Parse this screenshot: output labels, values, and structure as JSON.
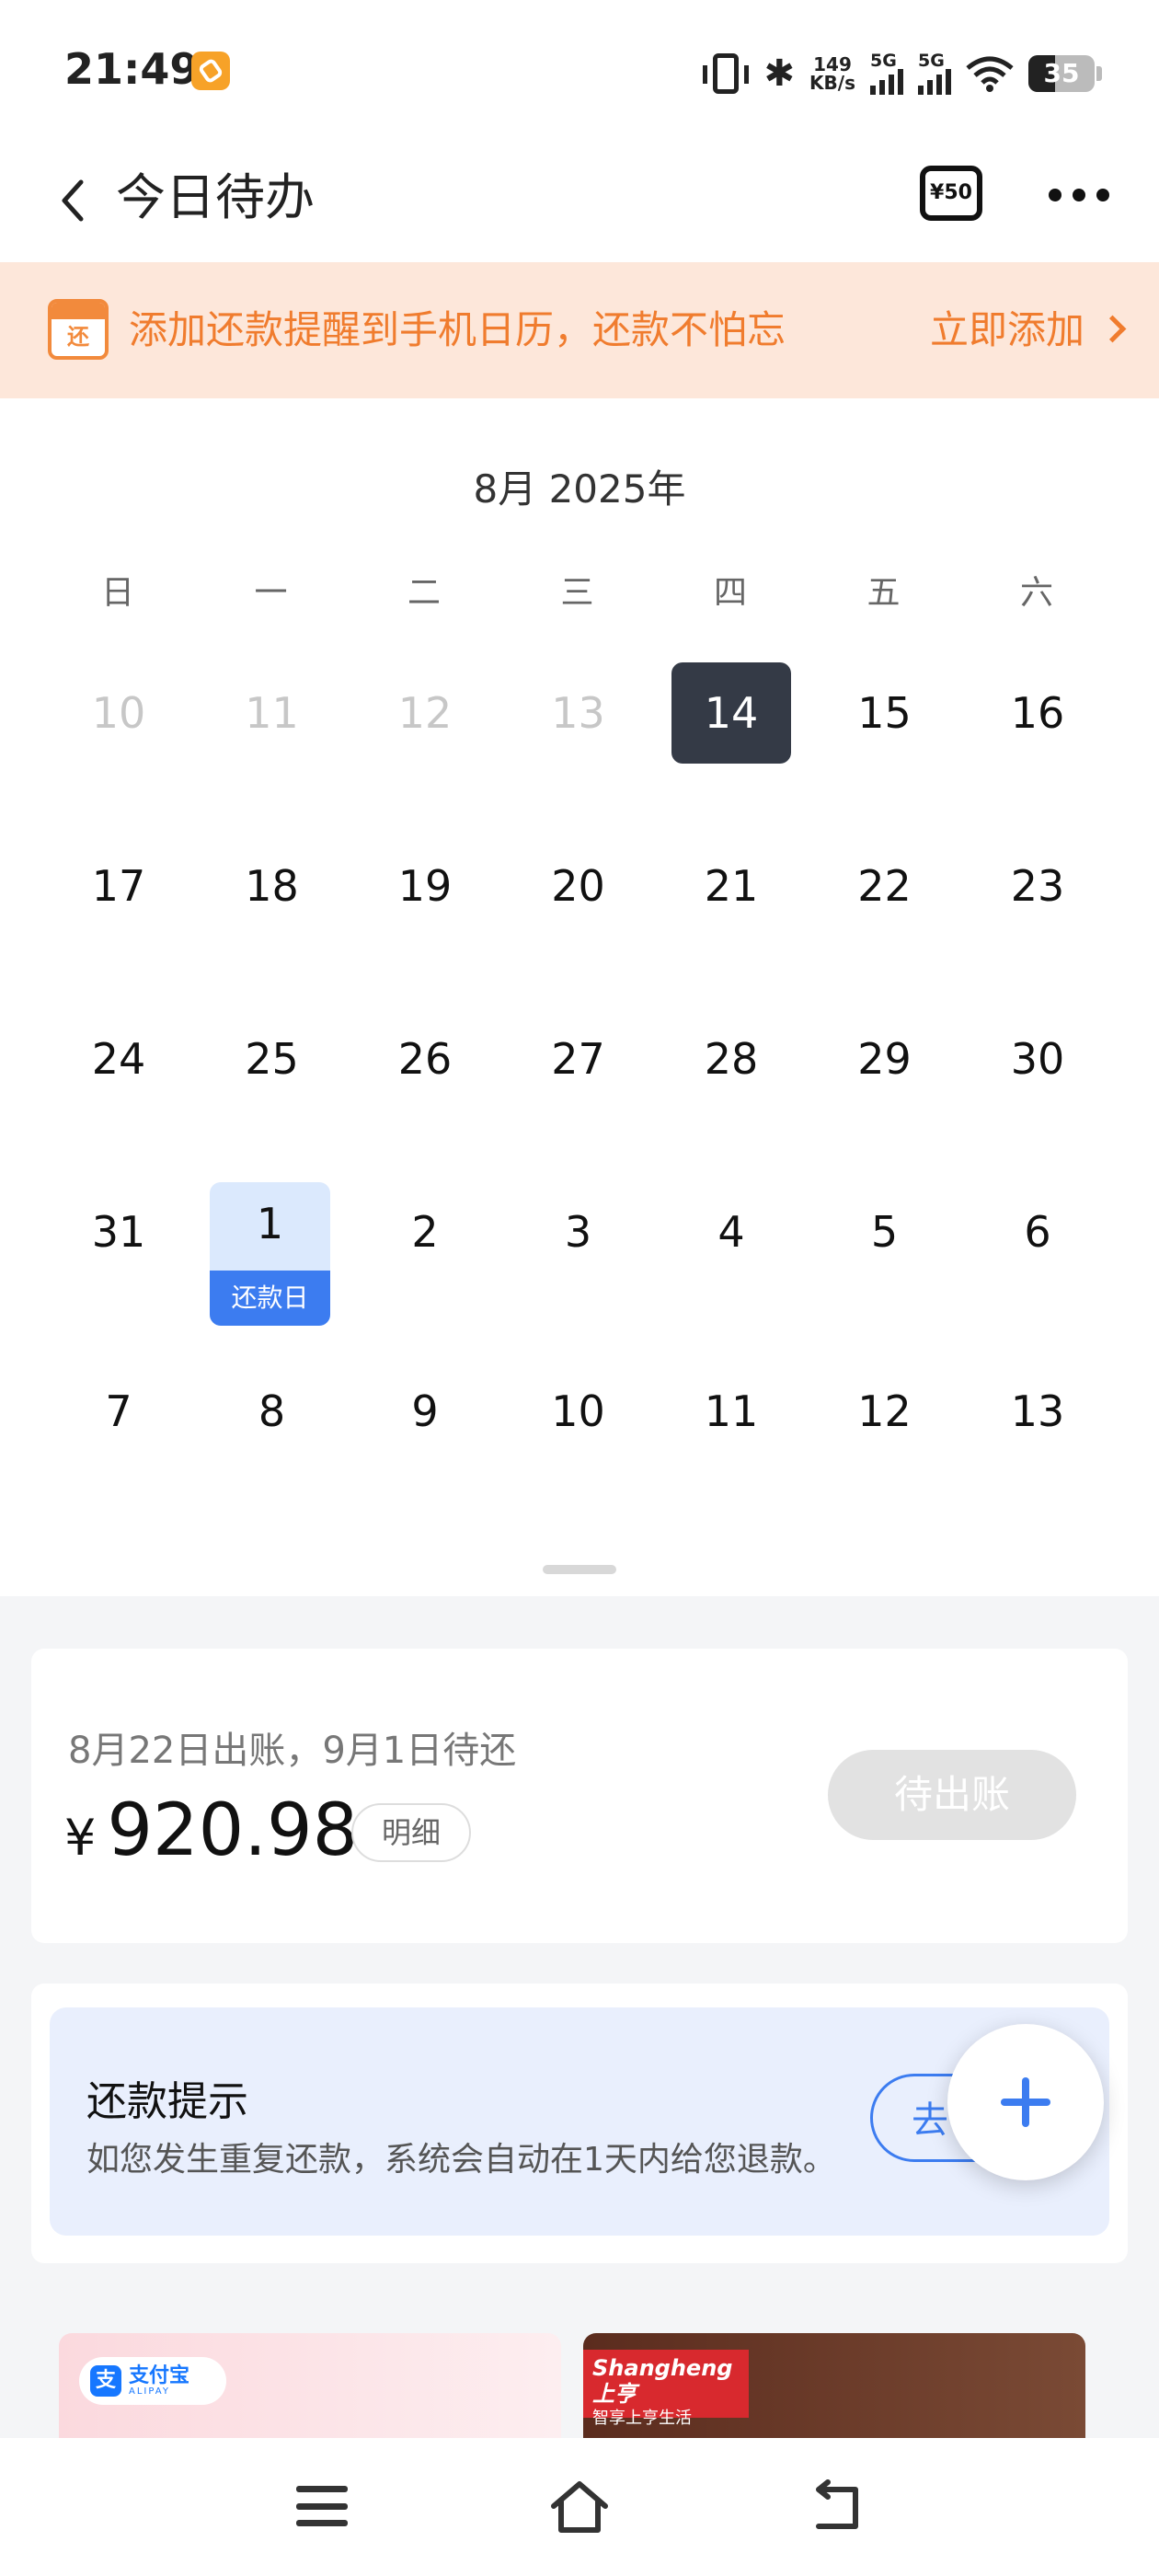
{
  "status_bar": {
    "time": "21:49",
    "net_speed_value": "149",
    "net_speed_unit": "KB/s",
    "sim1_label": "5G",
    "sim2_label": "5G",
    "battery": "35",
    "icons": [
      "app-notification-icon",
      "vibrate-icon",
      "bluetooth-icon",
      "signal-icon",
      "wifi-icon",
      "battery-icon"
    ]
  },
  "header": {
    "title": "今日待办",
    "coupon_label": "¥50",
    "icons": [
      "back-icon",
      "coupon-icon",
      "more-icon"
    ]
  },
  "banner": {
    "badge": "还",
    "text": "添加还款提醒到手机日历，还款不怕忘",
    "action": "立即添加",
    "color": "#f07c2e"
  },
  "calendar": {
    "title": "8月 2025年",
    "weekdays": [
      "日",
      "一",
      "二",
      "三",
      "四",
      "五",
      "六"
    ],
    "weeks": [
      [
        "10",
        "11",
        "12",
        "13",
        "14",
        "15",
        "16"
      ],
      [
        "17",
        "18",
        "19",
        "20",
        "21",
        "22",
        "23"
      ],
      [
        "24",
        "25",
        "26",
        "27",
        "28",
        "29",
        "30"
      ],
      [
        "31",
        "1",
        "2",
        "3",
        "4",
        "5",
        "6"
      ],
      [
        "7",
        "8",
        "9",
        "10",
        "11",
        "12",
        "13"
      ]
    ],
    "today": "14",
    "due_day": "1",
    "due_tag": "还款日",
    "today_color": "#343a46",
    "due_color": "#3c7cf0"
  },
  "bill": {
    "description": "8月22日出账，9月1日待还",
    "currency": "¥",
    "amount": "920.98",
    "detail_label": "明细",
    "status_button": "待出账"
  },
  "notice": {
    "title": "还款提示",
    "text": "如您发生重复还款，系统会自动在1天内给您退款。",
    "button_label": "去"
  },
  "promos": {
    "left_logo_mark": "支",
    "left_logo_name": "支付宝",
    "left_logo_sub": "ALIPAY",
    "right_logo_title": "Shangheng上亨",
    "right_logo_sub": "智享上亨生活"
  },
  "navbar": {
    "icons": [
      "menu-icon",
      "home-icon",
      "back-nav-icon"
    ]
  }
}
